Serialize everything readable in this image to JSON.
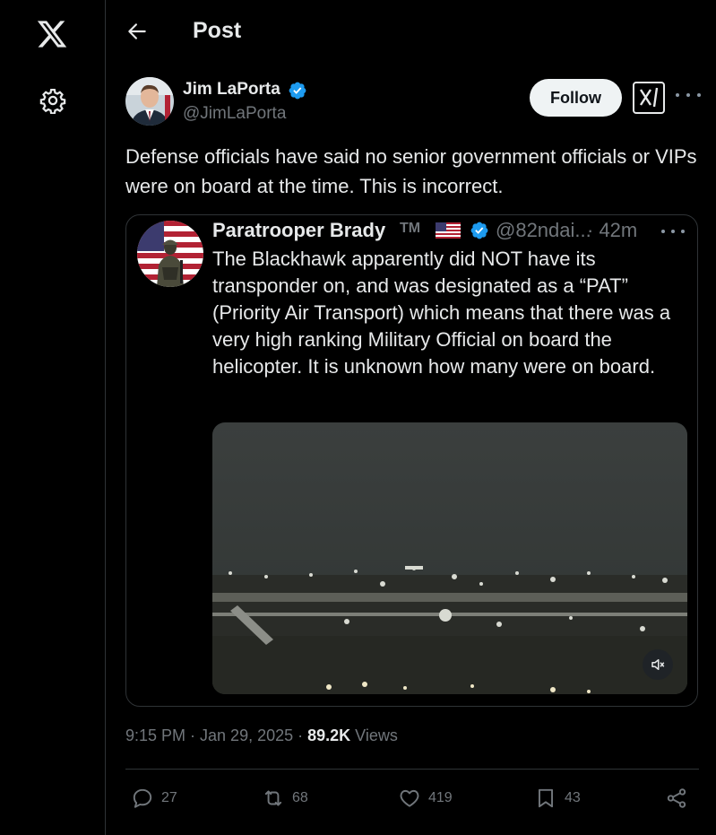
{
  "header": {
    "title": "Post"
  },
  "post": {
    "author_name": "Jim LaPorta",
    "author_handle": "@JimLaPorta",
    "follow_label": "Follow",
    "text": "Defense officials have said no senior government officials or VIPs were on board at the time. This is incorrect.",
    "timestamp": "9:15 PM · Jan 29, 2025 · ",
    "views_count": "89.2K",
    "views_label": " Views"
  },
  "quote": {
    "author_name": "Paratrooper Brady",
    "tm": "TM",
    "author_handle": "@82ndai...",
    "time": "· 42m",
    "text": "The Blackhawk apparently did NOT have its transponder on, and was designated as a “PAT” (Priority Air Transport) which means that there was a very high ranking Military Official on board the helicopter. It is unknown how many were on board."
  },
  "actions": {
    "replies": "27",
    "reposts": "68",
    "likes": "419",
    "bookmarks": "43"
  },
  "icons": {
    "logo": "x-logo-icon",
    "settings": "gear-icon",
    "back": "back-arrow-icon",
    "verified": "verified-badge-icon",
    "grok": "grok-icon",
    "more": "more-dots-icon",
    "mute": "mute-icon",
    "reply": "reply-icon",
    "repost": "repost-icon",
    "like": "heart-icon",
    "bookmark": "bookmark-icon",
    "share": "share-icon"
  },
  "colors": {
    "background": "#000000",
    "text_primary": "#e7e9ea",
    "text_secondary": "#71767b",
    "border": "#2f3336",
    "verified_blue": "#1d9bf0",
    "follow_bg": "#eff3f4"
  }
}
